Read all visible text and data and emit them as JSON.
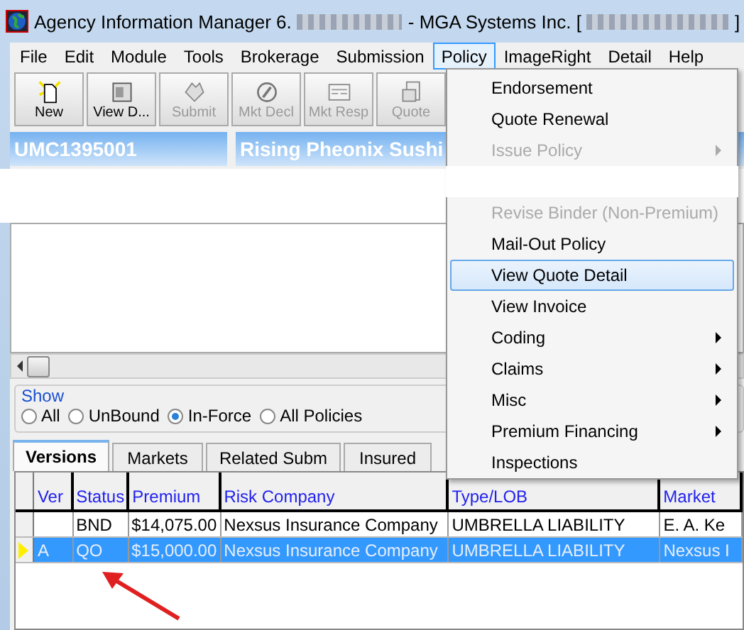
{
  "window": {
    "title_parts": [
      "Agency Information Manager 6.",
      "- MGA Systems Inc. [",
      "]"
    ]
  },
  "menubar": [
    {
      "label": "File",
      "selected": false
    },
    {
      "label": "Edit",
      "selected": false
    },
    {
      "label": "Module",
      "selected": false
    },
    {
      "label": "Tools",
      "selected": false
    },
    {
      "label": "Brokerage",
      "selected": false
    },
    {
      "label": "Submission",
      "selected": false
    },
    {
      "label": "Policy",
      "selected": true
    },
    {
      "label": "ImageRight",
      "selected": false
    },
    {
      "label": "Detail",
      "selected": false
    },
    {
      "label": "Help",
      "selected": false
    }
  ],
  "toolbar": [
    {
      "label": "New",
      "disabled": false
    },
    {
      "label": "View D...",
      "disabled": false
    },
    {
      "label": "Submit",
      "disabled": true
    },
    {
      "label": "Mkt Decl",
      "disabled": true
    },
    {
      "label": "Mkt Resp",
      "disabled": true
    },
    {
      "label": "Quote",
      "disabled": true
    }
  ],
  "header": {
    "policy_number": "UMC1395001",
    "insured_name": "Rising Pheonix Sushi"
  },
  "show": {
    "label": "Show",
    "options": [
      {
        "label": "All",
        "selected": false
      },
      {
        "label": "UnBound",
        "selected": false
      },
      {
        "label": "In-Force",
        "selected": true
      },
      {
        "label": "All Policies",
        "selected": false
      }
    ]
  },
  "tabs": [
    {
      "label": "Versions",
      "selected": true
    },
    {
      "label": "Markets",
      "selected": false
    },
    {
      "label": "Related Subm",
      "selected": false
    },
    {
      "label": "Insured",
      "selected": false
    }
  ],
  "grid": {
    "columns": [
      "Ver",
      "Status",
      "Premium",
      "Risk Company",
      "Type/LOB",
      "Market"
    ],
    "rows": [
      {
        "selected": false,
        "current": false,
        "cells": [
          "",
          "BND",
          "$14,075.00",
          "Nexsus Insurance Company",
          "UMBRELLA LIABILITY",
          "E. A. Ke"
        ]
      },
      {
        "selected": true,
        "current": true,
        "cells": [
          "A",
          "QO",
          "$15,000.00",
          "Nexsus Insurance Company",
          "UMBRELLA LIABILITY",
          "Nexsus I"
        ]
      }
    ]
  },
  "policy_menu": [
    {
      "label": "Endorsement",
      "disabled": false,
      "submenu": false,
      "highlighted": false
    },
    {
      "label": "Quote Renewal",
      "disabled": false,
      "submenu": false,
      "highlighted": false
    },
    {
      "label": "Issue Policy",
      "disabled": true,
      "submenu": true,
      "highlighted": false
    },
    {
      "label": "Revise Binder (Non-Premium)",
      "disabled": true,
      "submenu": false,
      "highlighted": false
    },
    {
      "label": "Mail-Out Policy",
      "disabled": false,
      "submenu": false,
      "highlighted": false
    },
    {
      "label": "View Quote Detail",
      "disabled": false,
      "submenu": false,
      "highlighted": true
    },
    {
      "label": "View Invoice",
      "disabled": false,
      "submenu": false,
      "highlighted": false
    },
    {
      "label": "Coding",
      "disabled": false,
      "submenu": true,
      "highlighted": false
    },
    {
      "label": "Claims",
      "disabled": false,
      "submenu": true,
      "highlighted": false
    },
    {
      "label": "Misc",
      "disabled": false,
      "submenu": true,
      "highlighted": false
    },
    {
      "label": "Premium Financing",
      "disabled": false,
      "submenu": true,
      "highlighted": false
    },
    {
      "label": "Inspections",
      "disabled": false,
      "submenu": false,
      "highlighted": false
    }
  ]
}
